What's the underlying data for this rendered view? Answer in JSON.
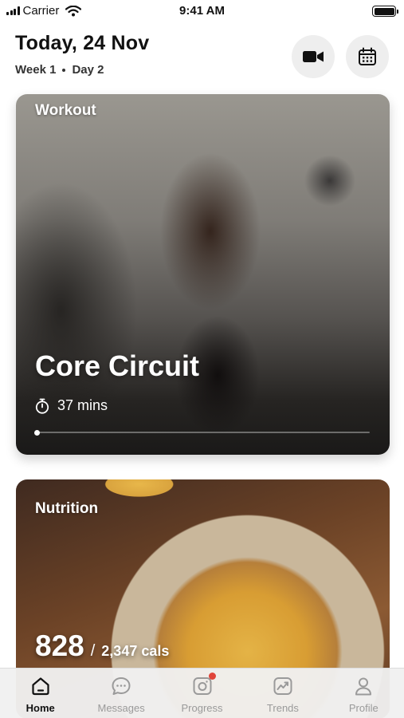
{
  "status_bar": {
    "carrier": "Carrier",
    "time": "9:41 AM",
    "battery_level": 1.0
  },
  "header": {
    "title": "Today, 24 Nov",
    "week": "Week 1",
    "day": "Day 2",
    "video_icon": "video-camera-icon",
    "calendar_icon": "calendar-icon"
  },
  "workout": {
    "label": "Workout",
    "title": "Core Circuit",
    "duration": "37 mins",
    "duration_icon": "stopwatch-icon",
    "progress": 0.0
  },
  "nutrition": {
    "label": "Nutrition",
    "calories": "828",
    "separator": "/",
    "goal": "2,347 cals"
  },
  "tab_bar": {
    "tabs": [
      {
        "label": "Home",
        "icon": "home-icon",
        "active": true
      },
      {
        "label": "Messages",
        "icon": "chat-bubble-icon",
        "active": false
      },
      {
        "label": "Progress",
        "icon": "camera-icon",
        "active": false,
        "badge": true
      },
      {
        "label": "Trends",
        "icon": "trend-chart-icon",
        "active": false
      },
      {
        "label": "Profile",
        "icon": "person-icon",
        "active": false
      }
    ]
  },
  "colors": {
    "accent": "#111111",
    "inactive": "#9a9a9a",
    "badge": "#e0453a"
  }
}
